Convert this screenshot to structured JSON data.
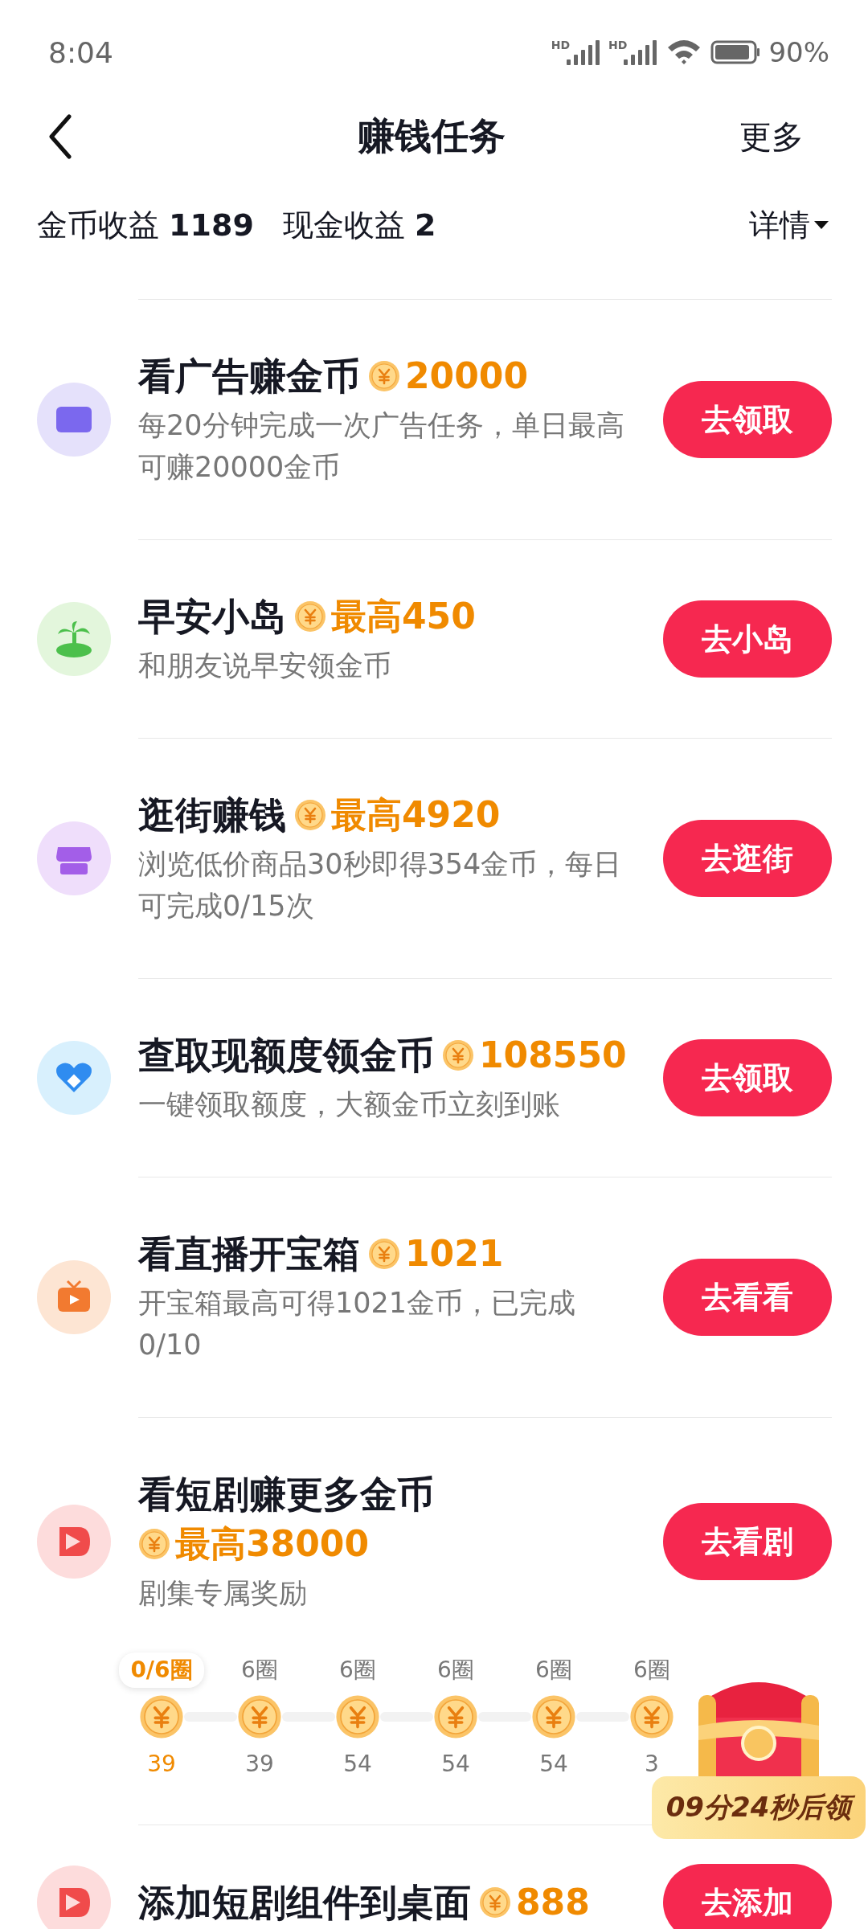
{
  "status_bar": {
    "time": "8:04",
    "signals": [
      {
        "label": "HD"
      },
      {
        "label": "HD"
      }
    ],
    "battery": "90%"
  },
  "nav": {
    "title": "赚钱任务",
    "more": "更多"
  },
  "earnings": {
    "items": [
      {
        "label": "金币收益",
        "value": "1189"
      },
      {
        "label": "现金收益",
        "value": "2"
      }
    ],
    "details": "详情"
  },
  "tasks": [
    {
      "title": "看广告赚金币",
      "reward": "20000",
      "reward_on_new_line": false,
      "description": "每20分钟完成一次广告任务，单日最高可赚20000金币",
      "button": "去领取"
    },
    {
      "title": "早安小岛",
      "reward": "最高450",
      "reward_on_new_line": false,
      "description": "和朋友说早安领金币",
      "button": "去小岛"
    },
    {
      "title": "逛街赚钱",
      "reward": "最高4920",
      "reward_on_new_line": false,
      "description": "浏览低价商品30秒即得354金币，每日可完成0/15次",
      "button": "去逛街"
    },
    {
      "title": "查取现额度领金币",
      "reward": "108550",
      "reward_on_new_line": false,
      "description": "一键领取额度，大额金币立刻到账",
      "button": "去领取"
    },
    {
      "title": "看直播开宝箱",
      "reward": "1021",
      "reward_on_new_line": false,
      "description": "开宝箱最高可得1021金币，已完成0/10",
      "button": "去看看"
    },
    {
      "title": "看短剧赚更多金币",
      "reward": "最高38000",
      "reward_on_new_line": true,
      "description": "剧集专属奖励",
      "button": "去看剧",
      "progress": {
        "steps": [
          {
            "label": "0/6圈",
            "value": "39",
            "selected": true
          },
          {
            "label": "6圈",
            "value": "39",
            "selected": false
          },
          {
            "label": "6圈",
            "value": "54",
            "selected": false
          },
          {
            "label": "6圈",
            "value": "54",
            "selected": false
          },
          {
            "label": "6圈",
            "value": "54",
            "selected": false
          },
          {
            "label": "6圈",
            "value": "3",
            "selected": false
          }
        ],
        "chest_timer": "09分24秒后领"
      }
    },
    {
      "title": "添加短剧组件到桌面",
      "reward": "888",
      "reward_on_new_line": false,
      "button": "去添加"
    }
  ]
}
